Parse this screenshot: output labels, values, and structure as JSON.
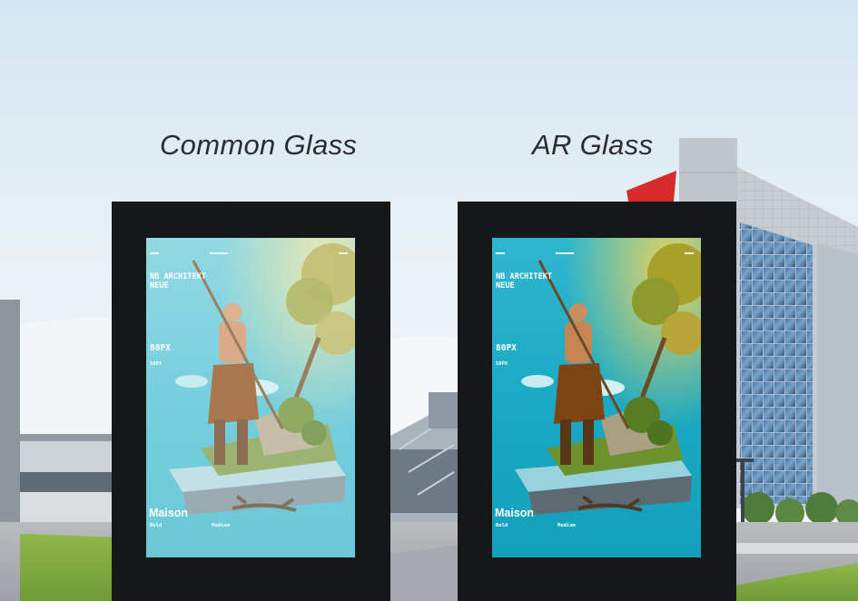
{
  "captions": {
    "left": "Common Glass",
    "right": "AR Glass"
  },
  "poster": {
    "headline": "NB ARCHITEKT NEUE",
    "size_large": "80PX",
    "size_small": "50PX",
    "brand": "Maison",
    "weight_bold": "Bold",
    "weight_medium": "Medium"
  },
  "colors": {
    "kiosk_frame": "#161719",
    "sky_top": "#d7e9f2",
    "poster_cyan": "#2fbad0",
    "caption_text": "#2b2d31"
  }
}
